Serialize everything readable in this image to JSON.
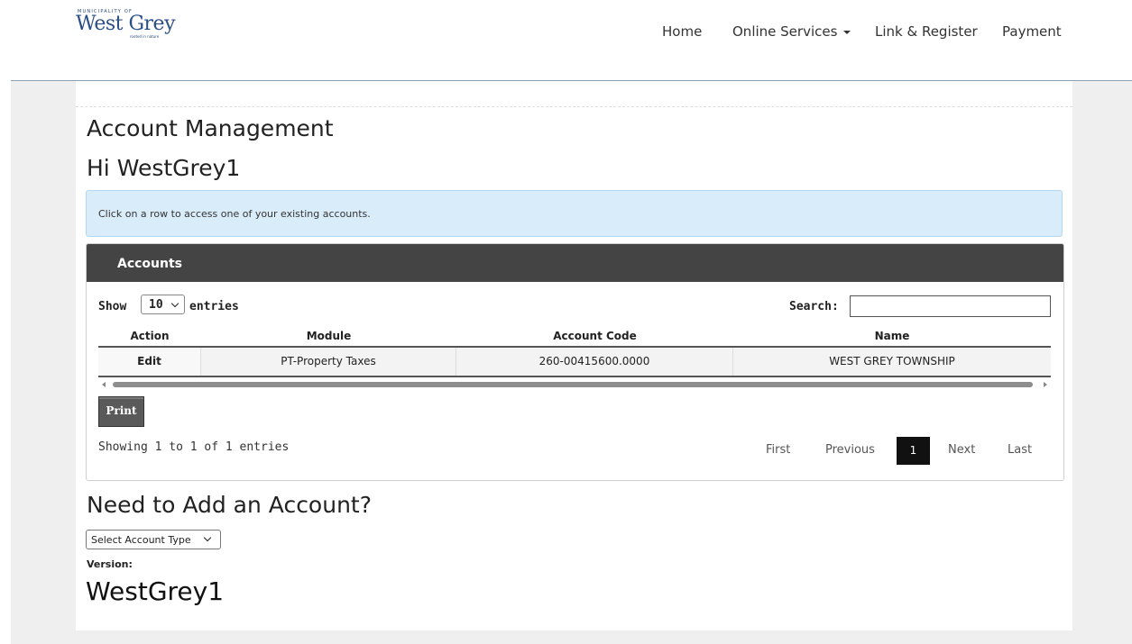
{
  "header": {
    "logo": {
      "small": "MUNICIPALITY OF",
      "name": "West Grey",
      "tagline": "rooted in nature"
    },
    "nav": [
      {
        "label": "Home"
      },
      {
        "label": "Online Services"
      },
      {
        "label": "Link & Register"
      },
      {
        "label": "Payment"
      }
    ]
  },
  "page": {
    "title": "Account Management",
    "greeting": "Hi WestGrey1",
    "info_text": "Click on a row to access one of your existing accounts."
  },
  "accounts": {
    "panel_title": "Accounts",
    "show_label": "Show",
    "entries_value": "10",
    "entries_label": "entries",
    "search_label": "Search:",
    "search_value": "",
    "columns": [
      "Action",
      "Module",
      "Account Code",
      "Name"
    ],
    "rows": [
      {
        "action": "Edit",
        "module": "PT-Property Taxes",
        "account_code": "260-00415600.0000",
        "name": "WEST GREY TOWNSHIP"
      }
    ],
    "print_label": "Print",
    "info": "Showing 1 to 1 of 1 entries",
    "pagination": {
      "first": "First",
      "previous": "Previous",
      "current": "1",
      "next": "Next",
      "last": "Last"
    }
  },
  "add_account": {
    "title": "Need to Add an Account?",
    "select_value": "Select Account Type",
    "version_label": "Version:",
    "version_value": "WestGrey1"
  }
}
